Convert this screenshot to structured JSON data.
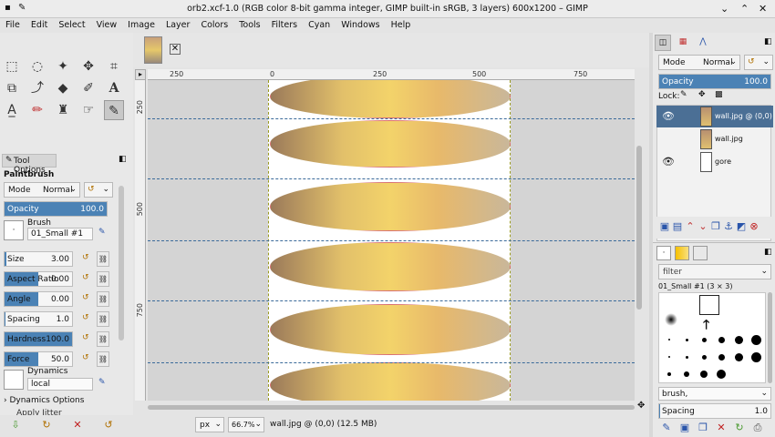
{
  "window": {
    "title": "orb2.xcf-1.0 (RGB color 8-bit gamma integer, GIMP built-in sRGB, 3 layers) 600x1200 – GIMP"
  },
  "menu": [
    "File",
    "Edit",
    "Select",
    "View",
    "Image",
    "Layer",
    "Colors",
    "Tools",
    "Filters",
    "Cyan",
    "Windows",
    "Help"
  ],
  "tool_options": {
    "tab": "Tool Options",
    "tool_name": "Paintbrush",
    "mode_label": "Mode",
    "mode_value": "Normal",
    "opacity_label": "Opacity",
    "opacity_value": "100.0",
    "brush_label": "Brush",
    "brush_value": "01_Small #1",
    "params": [
      {
        "label": "Size",
        "value": "3.00",
        "fraction": 0.03
      },
      {
        "label": "Aspect Ratio",
        "value": "0.00",
        "fraction": 0.5
      },
      {
        "label": "Angle",
        "value": "0.00",
        "fraction": 0.5
      },
      {
        "label": "Spacing",
        "value": "1.0",
        "fraction": 0.01
      },
      {
        "label": "Hardness",
        "value": "100.0",
        "fraction": 1.0
      },
      {
        "label": "Force",
        "value": "50.0",
        "fraction": 0.5
      }
    ],
    "dynamics_label": "Dynamics",
    "dynamics_value": "local",
    "dynamics_options": "Dynamics Options",
    "apply_jitter": "Apply Jitter"
  },
  "rulers": {
    "h": [
      "250",
      "0",
      "250",
      "500",
      "750"
    ],
    "v": [
      "250",
      "500",
      "750"
    ]
  },
  "statusbar": {
    "unit": "px",
    "zoom": "66.7%",
    "info": "wall.jpg @ (0,0) (12.5 MB)"
  },
  "layers": {
    "mode_label": "Mode",
    "mode_value": "Normal",
    "opacity_label": "Opacity",
    "opacity_value": "100.0",
    "lock_label": "Lock:",
    "items": [
      {
        "name": "wall.jpg @ (0,0)",
        "visible": true,
        "selected": true
      },
      {
        "name": "wall.jpg",
        "visible": false,
        "selected": false
      },
      {
        "name": "gore",
        "visible": true,
        "selected": false
      }
    ]
  },
  "brushes": {
    "filter": "filter",
    "brush_name": "01_Small #1 (3 × 3)",
    "tag": "brush,",
    "spacing_label": "Spacing",
    "spacing_value": "1.0"
  }
}
